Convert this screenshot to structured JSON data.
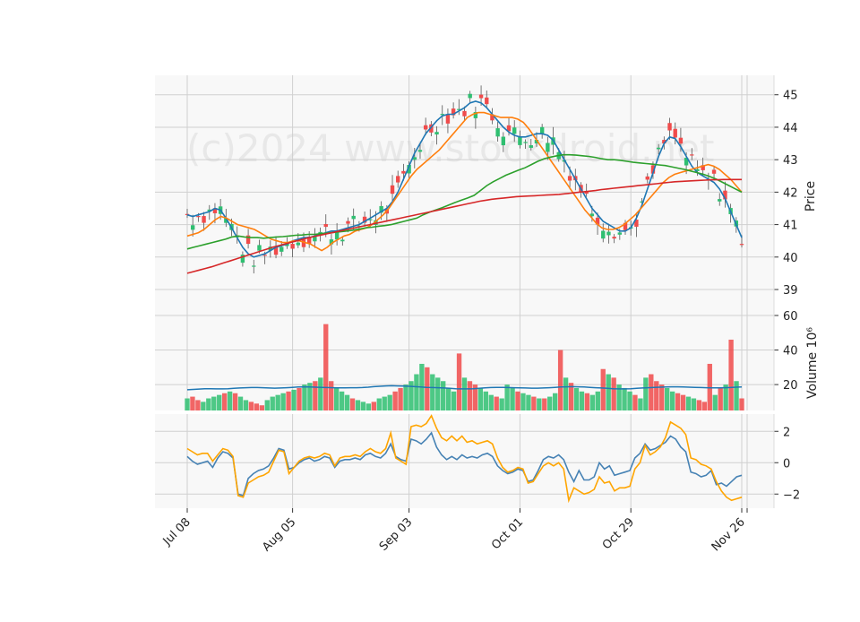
{
  "watermark": "(c)2024 www.stockdroid.net",
  "colors": {
    "up": "#2fbf71",
    "down": "#f04b4b",
    "ma_fast": "#1f77b4",
    "ma_mid": "#ff7f0e",
    "ma_slow": "#2ca02c",
    "ma_long": "#d62728",
    "vol_ma": "#1f77b4",
    "ind1": "#4682b4",
    "ind2": "#ffa500",
    "panel_bg": "#f8f8f8",
    "grid": "#d0d0d0"
  },
  "chart_data": [
    {
      "type": "candlestick",
      "panel": "price",
      "ylabel": "Price",
      "ylim": [
        38.2,
        45.6
      ],
      "yticks": [
        39,
        40,
        41,
        42,
        43,
        44,
        45
      ],
      "x_ticks": [
        "Jul 08",
        "Aug 05",
        "Sep 03",
        "Oct 01",
        "Oct 29",
        "Nov 26"
      ],
      "grid": true,
      "series": [
        {
          "role": "ma_fast",
          "values": [
            41.3,
            41.25,
            41.3,
            41.35,
            41.4,
            41.5,
            41.45,
            41.2,
            40.9,
            40.6,
            40.3,
            40.1,
            40.0,
            40.05,
            40.1,
            40.2,
            40.3,
            40.35,
            40.4,
            40.5,
            40.55,
            40.6,
            40.6,
            40.65,
            40.7,
            40.75,
            40.8,
            40.8,
            40.85,
            40.9,
            40.95,
            41.0,
            41.1,
            41.2,
            41.3,
            41.4,
            41.5,
            41.7,
            42.0,
            42.4,
            42.8,
            43.2,
            43.5,
            43.8,
            44.0,
            44.2,
            44.35,
            44.4,
            44.4,
            44.5,
            44.6,
            44.75,
            44.8,
            44.75,
            44.6,
            44.4,
            44.2,
            44.0,
            43.85,
            43.75,
            43.7,
            43.7,
            43.75,
            43.8,
            43.8,
            43.75,
            43.6,
            43.3,
            43.0,
            42.7,
            42.4,
            42.1,
            41.8,
            41.5,
            41.3,
            41.1,
            41.0,
            40.9,
            40.8,
            40.8,
            40.9,
            41.2,
            41.6,
            42.1,
            42.6,
            43.1,
            43.5,
            43.7,
            43.65,
            43.4,
            43.1,
            42.8,
            42.6,
            42.5,
            42.4,
            42.3,
            42.1,
            41.8,
            41.4,
            41.0,
            40.6
          ]
        },
        {
          "role": "ma_mid",
          "values": [
            40.65,
            40.7,
            40.75,
            40.85,
            41.0,
            41.15,
            41.25,
            41.2,
            41.1,
            41.0,
            40.95,
            40.9,
            40.85,
            40.75,
            40.65,
            40.55,
            40.5,
            40.45,
            40.45,
            40.5,
            40.5,
            40.45,
            40.4,
            40.3,
            40.2,
            40.3,
            40.45,
            40.55,
            40.65,
            40.7,
            40.8,
            40.85,
            40.9,
            41.0,
            41.15,
            41.3,
            41.5,
            41.75,
            42.0,
            42.25,
            42.5,
            42.7,
            42.85,
            43.0,
            43.15,
            43.3,
            43.5,
            43.7,
            43.9,
            44.1,
            44.3,
            44.4,
            44.45,
            44.45,
            44.4,
            44.35,
            44.3,
            44.3,
            44.3,
            44.25,
            44.15,
            43.95,
            43.7,
            43.45,
            43.2,
            42.95,
            42.7,
            42.45,
            42.2,
            41.95,
            41.7,
            41.45,
            41.25,
            41.05,
            40.9,
            40.85,
            40.85,
            40.9,
            41.0,
            41.15,
            41.3,
            41.5,
            41.7,
            41.9,
            42.1,
            42.3,
            42.45,
            42.55,
            42.6,
            42.65,
            42.7,
            42.75,
            42.8,
            42.85,
            42.8,
            42.7,
            42.55,
            42.4,
            42.2,
            42.0
          ]
        },
        {
          "role": "ma_slow",
          "values": [
            40.25,
            40.3,
            40.35,
            40.4,
            40.45,
            40.5,
            40.55,
            40.62,
            40.65,
            40.62,
            40.6,
            40.6,
            40.58,
            40.6,
            40.62,
            40.63,
            40.65,
            40.67,
            40.68,
            40.7,
            40.7,
            40.72,
            40.74,
            40.76,
            40.78,
            40.8,
            40.83,
            40.86,
            40.9,
            40.92,
            40.95,
            40.97,
            41.0,
            41.05,
            41.1,
            41.15,
            41.2,
            41.3,
            41.38,
            41.45,
            41.52,
            41.6,
            41.68,
            41.75,
            41.82,
            41.9,
            42.05,
            42.2,
            42.32,
            42.42,
            42.52,
            42.6,
            42.68,
            42.75,
            42.85,
            42.95,
            43.03,
            43.08,
            43.12,
            43.15,
            43.15,
            43.14,
            43.12,
            43.1,
            43.07,
            43.03,
            43.0,
            43.0,
            42.98,
            42.95,
            42.92,
            42.9,
            42.88,
            42.86,
            42.84,
            42.82,
            42.78,
            42.74,
            42.7,
            42.65,
            42.6,
            42.55,
            42.48,
            42.4,
            42.3,
            42.2,
            42.1,
            42.0
          ]
        },
        {
          "role": "ma_long",
          "values": [
            39.5,
            39.55,
            39.6,
            39.65,
            39.7,
            39.76,
            39.82,
            39.88,
            39.94,
            40.0,
            40.06,
            40.12,
            40.18,
            40.24,
            40.3,
            40.35,
            40.4,
            40.45,
            40.5,
            40.55,
            40.6,
            40.64,
            40.68,
            40.72,
            40.76,
            40.8,
            40.84,
            40.88,
            40.92,
            40.96,
            41.0,
            41.04,
            41.08,
            41.12,
            41.16,
            41.2,
            41.24,
            41.28,
            41.32,
            41.36,
            41.4,
            41.44,
            41.48,
            41.52,
            41.56,
            41.6,
            41.64,
            41.68,
            41.72,
            41.75,
            41.78,
            41.8,
            41.82,
            41.84,
            41.86,
            41.87,
            41.88,
            41.89,
            41.9,
            41.91,
            41.92,
            41.93,
            41.95,
            41.97,
            41.99,
            42.01,
            42.03,
            42.05,
            42.08,
            42.1,
            42.12,
            42.14,
            42.16,
            42.18,
            42.2,
            42.22,
            42.24,
            42.26,
            42.28,
            42.3,
            42.32,
            42.33,
            42.34,
            42.35,
            42.36,
            42.37,
            42.38,
            42.38,
            42.39,
            42.39,
            42.39,
            42.39
          ]
        }
      ]
    },
    {
      "type": "bar",
      "panel": "volume",
      "ylabel": "Volume  10⁶",
      "ylim": [
        5,
        60
      ],
      "yticks": [
        20,
        40,
        60
      ],
      "grid": true,
      "values": [
        12,
        13,
        11,
        10,
        12,
        13,
        14,
        15,
        16,
        15,
        13,
        11,
        10,
        9,
        8,
        11,
        13,
        14,
        15,
        16,
        17,
        18,
        20,
        21,
        22,
        24,
        55,
        22,
        18,
        16,
        14,
        12,
        11,
        10,
        9,
        10,
        12,
        13,
        14,
        16,
        18,
        20,
        22,
        26,
        32,
        30,
        26,
        24,
        22,
        18,
        16,
        38,
        24,
        22,
        20,
        18,
        16,
        14,
        13,
        12,
        20,
        18,
        16,
        15,
        14,
        13,
        12,
        12,
        13,
        15,
        40,
        24,
        21,
        18,
        16,
        15,
        14,
        16,
        29,
        26,
        24,
        20,
        18,
        16,
        14,
        12,
        24,
        26,
        22,
        20,
        18,
        16,
        15,
        14,
        13,
        12,
        11,
        10,
        32,
        14,
        18,
        20,
        46,
        22,
        12
      ],
      "up": [
        1,
        0,
        0,
        1,
        1,
        1,
        1,
        0,
        1,
        0,
        1,
        1,
        0,
        0,
        0,
        1,
        1,
        1,
        1,
        0,
        1,
        0,
        1,
        1,
        0,
        1,
        0,
        0,
        1,
        1,
        1,
        0,
        1,
        1,
        1,
        0,
        1,
        1,
        1,
        0,
        0,
        1,
        1,
        1,
        1,
        0,
        1,
        1,
        1,
        1,
        1,
        0,
        1,
        0,
        0,
        1,
        1,
        1,
        0,
        1,
        1,
        1,
        0,
        1,
        1,
        0,
        1,
        0,
        1,
        1,
        0,
        1,
        0,
        1,
        1,
        0,
        1,
        1,
        0,
        1,
        0,
        1,
        1,
        1,
        0,
        1,
        1,
        0,
        0,
        0,
        1,
        1,
        0,
        0,
        1,
        1,
        0,
        0,
        0,
        1,
        0,
        1,
        0,
        1,
        0
      ],
      "ma_values": [
        17,
        17.2,
        17.4,
        17.6,
        17.6,
        17.5,
        17.5,
        17.6,
        17.8,
        18,
        18.2,
        18.3,
        18.3,
        18.2,
        18,
        17.9,
        18,
        18.2,
        18.4,
        18.6,
        18.7,
        18.6,
        18.5,
        18.4,
        18.3,
        18.2,
        18.1,
        18.1,
        18.2,
        18.2,
        18.3,
        18.5,
        18.8,
        19,
        19.2,
        19.3,
        19.2,
        19.1,
        19,
        18.8,
        18.6,
        18.4,
        18.3,
        18.2,
        18,
        17.8,
        17.6,
        17.5,
        17.5,
        17.6,
        17.8,
        18.1,
        18.3,
        18.4,
        18.4,
        18.3,
        18.2,
        18.1,
        18,
        17.9,
        17.9,
        18,
        18.2,
        18.4,
        18.6,
        18.7,
        18.8,
        18.7,
        18.6,
        18.4,
        18.2,
        18,
        17.8,
        17.6,
        17.5,
        17.5,
        17.6,
        17.8,
        18,
        18.2,
        18.4,
        18.5,
        18.6,
        18.7,
        18.7,
        18.6,
        18.5,
        18.4,
        18.3,
        18.2,
        18.1,
        18.1,
        18.2,
        18.3,
        18.5,
        18.6
      ]
    },
    {
      "type": "line",
      "panel": "indicator",
      "ylim": [
        -2.9,
        3.1
      ],
      "yticks": [
        -2,
        0,
        2
      ],
      "grid": true,
      "series": [
        {
          "role": "ind1",
          "values": [
            0.4,
            0.1,
            -0.1,
            0.0,
            0.1,
            -0.3,
            0.3,
            0.7,
            0.6,
            0.3,
            -2.0,
            -2.1,
            -1.0,
            -0.7,
            -0.5,
            -0.4,
            -0.2,
            0.3,
            0.9,
            0.8,
            -0.4,
            -0.3,
            0.0,
            0.2,
            0.3,
            0.1,
            0.2,
            0.4,
            0.3,
            -0.3,
            0.1,
            0.2,
            0.2,
            0.3,
            0.2,
            0.5,
            0.6,
            0.4,
            0.3,
            0.6,
            1.2,
            0.4,
            0.2,
            0.1,
            1.5,
            1.4,
            1.2,
            1.5,
            1.9,
            1.0,
            0.5,
            0.2,
            0.4,
            0.2,
            0.5,
            0.3,
            0.4,
            0.3,
            0.5,
            0.6,
            0.4,
            -0.2,
            -0.5,
            -0.7,
            -0.6,
            -0.4,
            -0.5,
            -1.2,
            -1.1,
            -0.5,
            0.2,
            0.4,
            0.3,
            0.5,
            0.2,
            -0.6,
            -1.2,
            -0.5,
            -1.1,
            -1.1,
            -0.9,
            0.0,
            -0.4,
            -0.2,
            -0.8,
            -0.7,
            -0.6,
            -0.5,
            0.3,
            0.6,
            1.2,
            0.8,
            0.9,
            1.1,
            1.3,
            1.7,
            1.5,
            1.0,
            0.7,
            -0.6,
            -0.7,
            -0.9,
            -0.8,
            -0.5,
            -1.4,
            -1.3,
            -1.5,
            -1.2,
            -0.9,
            -0.8
          ]
        },
        {
          "role": "ind2",
          "values": [
            0.9,
            0.7,
            0.5,
            0.6,
            0.6,
            0.1,
            0.5,
            0.9,
            0.8,
            0.4,
            -2.1,
            -2.2,
            -1.3,
            -1.1,
            -0.9,
            -0.8,
            -0.6,
            0.1,
            0.8,
            0.7,
            -0.7,
            -0.3,
            0.1,
            0.3,
            0.4,
            0.3,
            0.4,
            0.6,
            0.5,
            -0.2,
            0.3,
            0.4,
            0.4,
            0.5,
            0.4,
            0.7,
            0.9,
            0.7,
            0.6,
            0.9,
            1.9,
            0.3,
            0.1,
            -0.1,
            2.3,
            2.4,
            2.3,
            2.5,
            3.0,
            2.2,
            1.6,
            1.4,
            1.7,
            1.4,
            1.7,
            1.3,
            1.4,
            1.2,
            1.3,
            1.4,
            1.2,
            0.3,
            -0.3,
            -0.6,
            -0.5,
            -0.3,
            -0.4,
            -1.3,
            -1.2,
            -0.7,
            -0.2,
            0.0,
            -0.2,
            0.0,
            -0.4,
            -2.4,
            -1.6,
            -1.8,
            -2.0,
            -1.9,
            -1.7,
            -0.9,
            -1.3,
            -1.2,
            -1.8,
            -1.6,
            -1.6,
            -1.5,
            -0.4,
            0.0,
            1.1,
            0.5,
            0.7,
            1.0,
            1.6,
            2.6,
            2.4,
            2.2,
            1.8,
            0.3,
            0.2,
            -0.1,
            -0.2,
            -0.4,
            -1.2,
            -1.8,
            -2.2,
            -2.4,
            -2.3,
            -2.2
          ]
        }
      ]
    }
  ]
}
